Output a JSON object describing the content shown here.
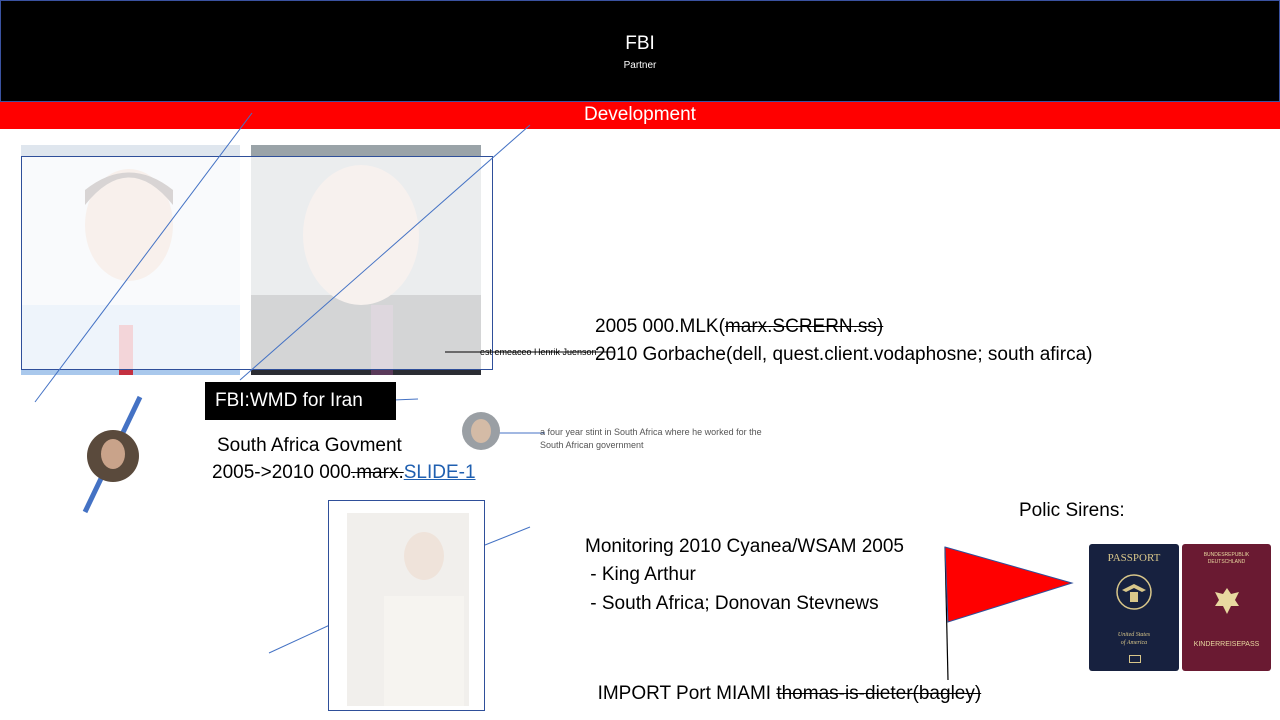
{
  "header": {
    "title": "FBI",
    "subtitle": "Partner",
    "background": "#000000"
  },
  "band": {
    "label": "Development",
    "color": "#ff0000"
  },
  "labels": {
    "fbi_wmd": "FBI:WMD for Iran"
  },
  "tiny_text": {
    "left_note": "est emeaceo Henrik Juenson",
    "right_note_line1": "a four year stint in South Africa where he worked for the",
    "right_note_line2": "South African government"
  },
  "timeline": {
    "line1_prefix": "2005 000.MLK(",
    "line1_strike": "marx.SCRERN.ss)",
    "line2": "2010 Gorbache(dell, quest.client.vodaphosne; south afirca)"
  },
  "south_africa": {
    "line1": "South Africa Govment",
    "line2_prefix": "2005->2010  000",
    "line2_strike": ".marx.",
    "link": "SLIDE-1"
  },
  "monitoring": {
    "title": "Monitoring 2010 Cyanea/WSAM 2005",
    "item1": " - King Arthur",
    "item2": " - South Africa; Donovan Stevnews"
  },
  "import": {
    "prefix": "IMPORT Port MIAMI ",
    "strike": "thomas-is-dieter(bagley)"
  },
  "polic": {
    "label": "Polic Sirens:"
  },
  "passports": {
    "us": {
      "title": "PASSPORT",
      "line1": "United States",
      "line2": "of America"
    },
    "de": {
      "line1": "BUNDESREPUBLIK",
      "line2": "DEUTSCHLAND",
      "bottom": "KINDERREISEPASS"
    }
  },
  "colors": {
    "accent_blue": "#4472c4",
    "flag_red": "#ff0000",
    "link": "#1f5fb0"
  }
}
